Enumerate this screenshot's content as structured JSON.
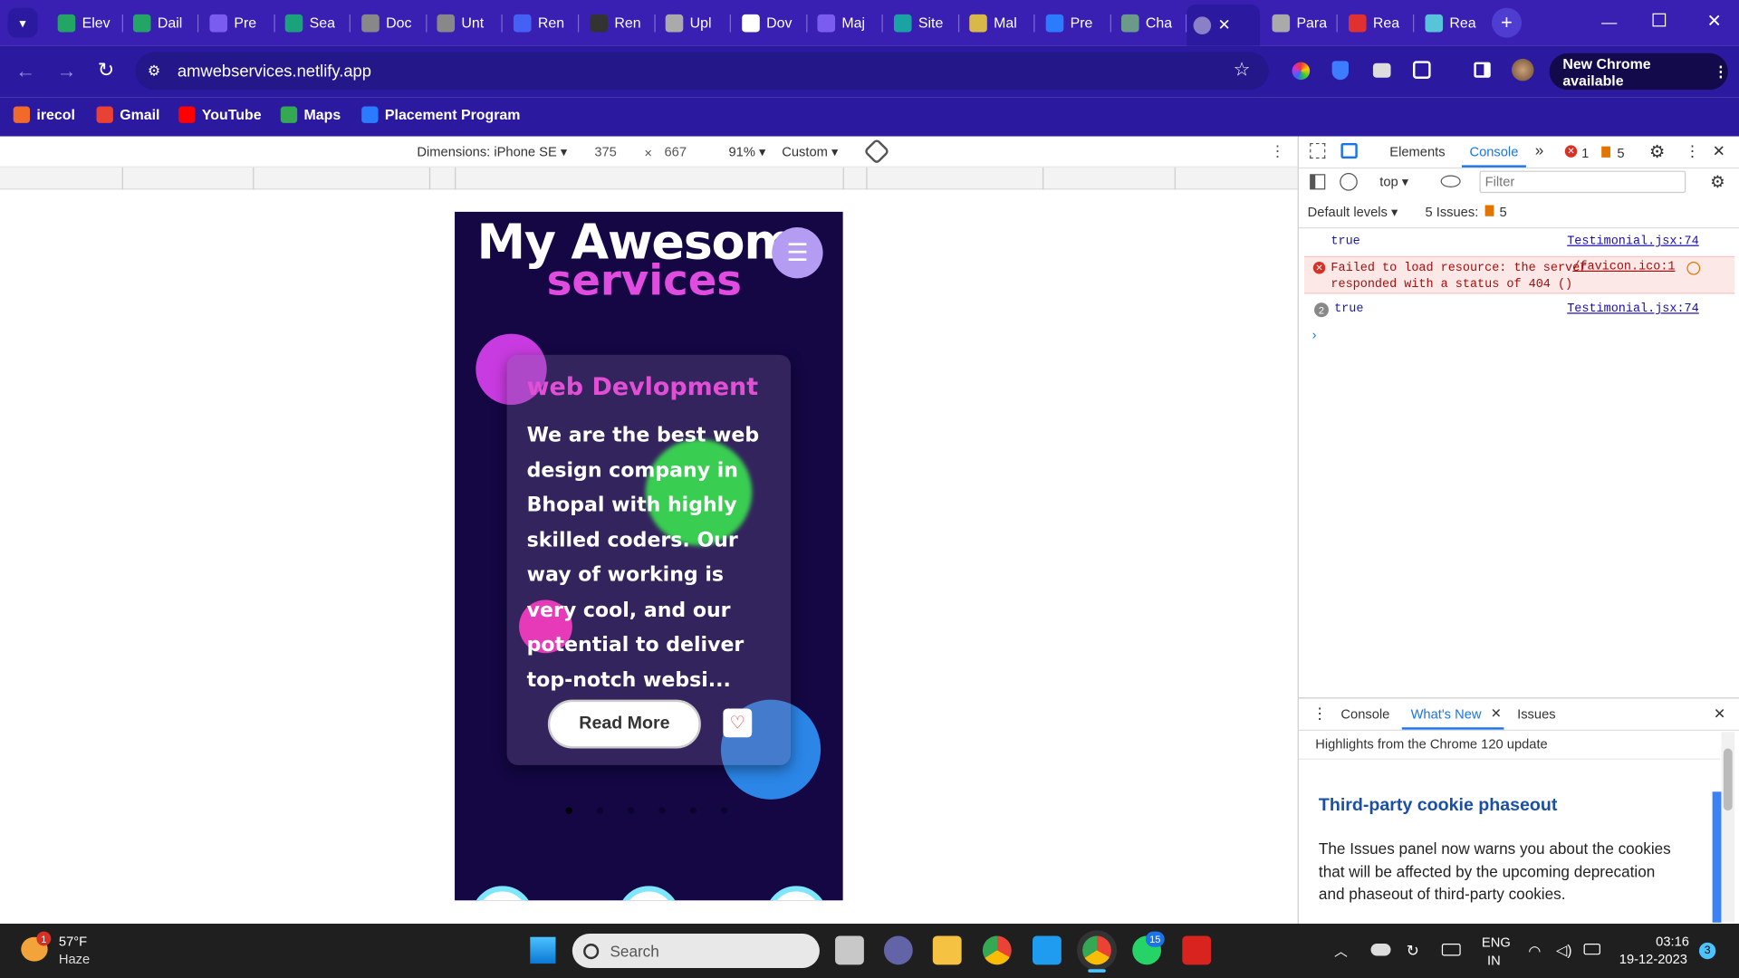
{
  "tabs": [
    {
      "label": "Elev",
      "color": "#23a566"
    },
    {
      "label": "Dail",
      "color": "#23a566"
    },
    {
      "label": "Pre",
      "color": "#7b5cf0"
    },
    {
      "label": "Sea",
      "color": "#1aa37a"
    },
    {
      "label": "Doc",
      "color": "#888888"
    },
    {
      "label": "Unt",
      "color": "#888888"
    },
    {
      "label": "Ren",
      "color": "#4460f5"
    },
    {
      "label": "Ren",
      "color": "#333333"
    },
    {
      "label": "Upl",
      "color": "#aaaaaa"
    },
    {
      "label": "Dov",
      "color": "#ffffff"
    },
    {
      "label": "Maj",
      "color": "#7b5cf0"
    },
    {
      "label": "Site",
      "color": "#1aa3a3"
    },
    {
      "label": "Mal",
      "color": "#d9b84a"
    },
    {
      "label": "Pre",
      "color": "#2b7bff"
    },
    {
      "label": "Cha",
      "color": "#6b9a8a"
    },
    {
      "label": "Para",
      "color": "#aaaaaa"
    },
    {
      "label": "Rea",
      "color": "#e03030"
    },
    {
      "label": "Rea",
      "color": "#58c4dc"
    }
  ],
  "browser": {
    "url": "amwebservices.netlify.app",
    "new_chrome": "New Chrome available"
  },
  "bookmarks": [
    {
      "label": "irecol",
      "color": "#f06a2a"
    },
    {
      "label": "Gmail",
      "color": "#e94235"
    },
    {
      "label": "YouTube",
      "color": "#ff0000"
    },
    {
      "label": "Maps",
      "color": "#34a853"
    },
    {
      "label": "Placement Program",
      "color": "#2b7bff"
    }
  ],
  "device_toolbar": {
    "dimensions": "Dimensions: iPhone SE",
    "width": "375",
    "times": "×",
    "height": "667",
    "zoom": "91%",
    "throttle": "Custom"
  },
  "site": {
    "title_line1": "My Awesom",
    "title_line2": "services",
    "card_title": "web Devlopment",
    "card_text": "We are the best web design company in Bhopal with highly skilled coders. Our way of working is very cool, and our potential to deliver top-notch websi...",
    "read_more": "Read More"
  },
  "devtools": {
    "tabs": [
      "Elements",
      "Console"
    ],
    "error_count": "1",
    "issue_count": "5",
    "context": "top",
    "filter_placeholder": "Filter",
    "levels": "Default levels",
    "issues_label": "5 Issues:",
    "issues_num": "5",
    "log": [
      {
        "text": "true",
        "source": "Testimonial.jsx:74",
        "type": "log"
      },
      {
        "text": "Failed to load resource: the server responded with a status of 404 ()",
        "source": "/favicon.ico:1",
        "type": "error"
      },
      {
        "text": "true",
        "source": "Testimonial.jsx:74",
        "type": "log",
        "count": "2"
      }
    ],
    "drawer_tabs": [
      "Console",
      "What's New",
      "Issues"
    ],
    "drawer_highlight": "Highlights from the Chrome 120 update",
    "whatsnew_title": "Third-party cookie phaseout",
    "whatsnew_body": "The Issues panel now warns you about the cookies that will be affected by the upcoming deprecation and phaseout of third-party cookies."
  },
  "taskbar": {
    "weather_temp": "57°F",
    "weather_desc": "Haze",
    "weather_badge": "1",
    "search": "Search",
    "whatsapp_badge": "15",
    "lang1": "ENG",
    "lang2": "IN",
    "time": "03:16",
    "date": "19-12-2023",
    "notif": "3"
  }
}
